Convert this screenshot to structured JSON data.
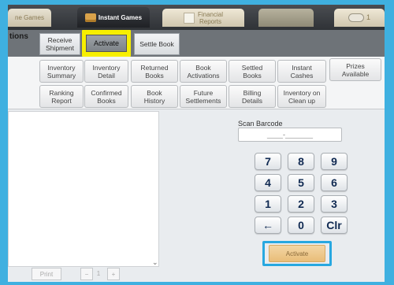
{
  "top_tabs": {
    "games": "ne Games",
    "instant": "Instant Games",
    "financial_line1": "Financial",
    "financial_line2": "Reports",
    "right_label": "1"
  },
  "actions": {
    "side_label": "tions",
    "receive_line1": "Receive",
    "receive_line2": "Shipment",
    "activate": "Activate",
    "settle": "Settle Book"
  },
  "reports_row1": [
    {
      "l1": "Inventory",
      "l2": "Summary"
    },
    {
      "l1": "Inventory",
      "l2": "Detail"
    },
    {
      "l1": "Returned",
      "l2": "Books"
    },
    {
      "l1": "Book",
      "l2": "Activations"
    },
    {
      "l1": "Settled",
      "l2": "Books"
    },
    {
      "l1": "Instant",
      "l2": "Cashes"
    },
    {
      "l1": "Prizes",
      "l2": "Available"
    }
  ],
  "reports_row2": [
    {
      "l1": "Ranking",
      "l2": "Report"
    },
    {
      "l1": "Confirmed",
      "l2": "Books"
    },
    {
      "l1": "Book",
      "l2": "History"
    },
    {
      "l1": "Future",
      "l2": "Settlements"
    },
    {
      "l1": "Billing",
      "l2": "Details"
    },
    {
      "l1": "Inventory on",
      "l2": "Clean up"
    }
  ],
  "scan": {
    "label": "Scan Barcode",
    "placeholder": "____-_______"
  },
  "keypad": {
    "k7": "7",
    "k8": "8",
    "k9": "9",
    "k4": "4",
    "k5": "5",
    "k6": "6",
    "k1": "1",
    "k2": "2",
    "k3": "3",
    "back": "←",
    "k0": "0",
    "clr": "Clr"
  },
  "activate_button": "Activate",
  "bottom": {
    "print": "Print",
    "minus": "−",
    "count": "1",
    "plus": "+"
  },
  "colors": {
    "highlight_yellow": "#f7ef00",
    "highlight_blue": "#28a8e0",
    "activate_orange": "#e9bd78"
  }
}
